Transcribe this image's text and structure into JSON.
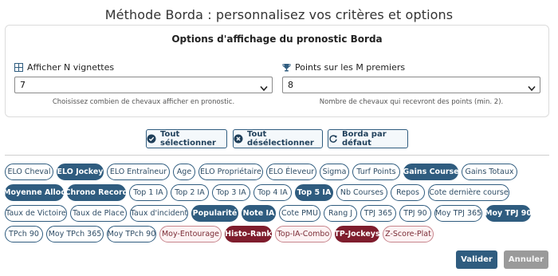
{
  "dialog": {
    "title": "Méthode Borda : personnalisez vos critères et options"
  },
  "options_panel": {
    "title": "Options d'affichage du pronostic Borda",
    "vignettes": {
      "label": "Afficher N vignettes",
      "icon": "grid-icon",
      "value": "7",
      "help": "Choisissez combien de chevaux afficher en pronostic."
    },
    "points": {
      "label": "Points sur les M premiers",
      "icon": "trophy-icon",
      "value": "8",
      "help": "Nombre de chevaux qui recevront des points (min. 2)."
    }
  },
  "actions": {
    "select_all": "Tout sélectionner",
    "deselect_all": "Tout désélectionner",
    "default": "Borda par défaut"
  },
  "criteria_rows": [
    [
      {
        "label": "ELO Cheval",
        "selected": false,
        "red": false
      },
      {
        "label": "ELO Jockey",
        "selected": true,
        "red": false
      },
      {
        "label": "ELO Entraîneur",
        "selected": false,
        "red": false
      },
      {
        "label": "Age",
        "selected": false,
        "red": false
      },
      {
        "label": "ELO Propriétaire",
        "selected": false,
        "red": false
      },
      {
        "label": "ELO Éleveur",
        "selected": false,
        "red": false
      },
      {
        "label": "Sigma",
        "selected": false,
        "red": false
      },
      {
        "label": "Turf Points",
        "selected": false,
        "red": false
      },
      {
        "label": "Gains Course",
        "selected": true,
        "red": false
      },
      {
        "label": "Gains Totaux",
        "selected": false,
        "red": false
      }
    ],
    [
      {
        "label": "Moyenne Alloc",
        "selected": true,
        "red": false
      },
      {
        "label": "Chrono Record",
        "selected": true,
        "red": false
      },
      {
        "label": "Top 1 IA",
        "selected": false,
        "red": false
      },
      {
        "label": "Top 2 IA",
        "selected": false,
        "red": false
      },
      {
        "label": "Top 3 IA",
        "selected": false,
        "red": false
      },
      {
        "label": "Top 4 IA",
        "selected": false,
        "red": false
      },
      {
        "label": "Top 5 IA",
        "selected": true,
        "red": false
      },
      {
        "label": "Nb Courses",
        "selected": false,
        "red": false
      },
      {
        "label": "Repos",
        "selected": false,
        "red": false
      },
      {
        "label": "Cote dernière course",
        "selected": false,
        "red": false
      }
    ],
    [
      {
        "label": "Taux de Victoire",
        "selected": false,
        "red": false
      },
      {
        "label": "Taux de Place",
        "selected": false,
        "red": false
      },
      {
        "label": "Taux d'incident",
        "selected": false,
        "red": false
      },
      {
        "label": "Popularité",
        "selected": true,
        "red": false
      },
      {
        "label": "Note IA",
        "selected": true,
        "red": false
      },
      {
        "label": "Cote PMU",
        "selected": false,
        "red": false
      },
      {
        "label": "Rang J",
        "selected": false,
        "red": false
      },
      {
        "label": "TPJ 365",
        "selected": false,
        "red": false
      },
      {
        "label": "TPJ 90",
        "selected": false,
        "red": false
      },
      {
        "label": "Moy TPJ 365",
        "selected": false,
        "red": false
      },
      {
        "label": "Moy TPJ 90",
        "selected": true,
        "red": false
      }
    ],
    [
      {
        "label": "TPch 90",
        "selected": false,
        "red": false
      },
      {
        "label": "Moy TPch 365",
        "selected": false,
        "red": false
      },
      {
        "label": "Moy TPch 90",
        "selected": false,
        "red": false
      },
      {
        "label": "Moy-Entourage",
        "selected": false,
        "red": true
      },
      {
        "label": "Histo-Rank",
        "selected": true,
        "red": true
      },
      {
        "label": "Top-IA-Combo",
        "selected": false,
        "red": true
      },
      {
        "label": "TP-Jockeys",
        "selected": true,
        "red": true
      },
      {
        "label": "Z-Score-Plat",
        "selected": false,
        "red": true
      }
    ]
  ],
  "footer": {
    "validate": "Valider",
    "cancel": "Annuler"
  },
  "colors": {
    "accent": "#2f5c7f",
    "accent_red": "#7f1d2d",
    "muted": "#9a9a9a"
  }
}
